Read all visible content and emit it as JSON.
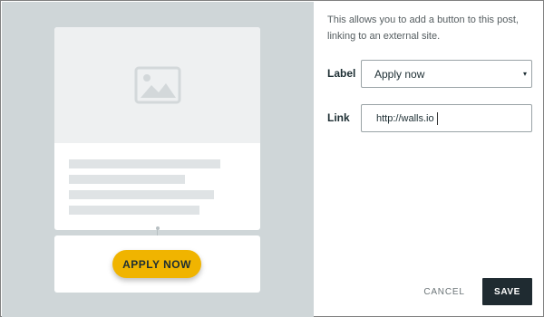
{
  "preview": {
    "image_icon": "image-placeholder-icon",
    "button_label": "APPLY NOW",
    "button_color": "#f0b400"
  },
  "form": {
    "description": "This allows you to add a button to this post, linking to an external site.",
    "label_field": {
      "label": "Label",
      "selected": "Apply now",
      "caret": "▾"
    },
    "link_field": {
      "label": "Link",
      "value": "http://walls.io"
    },
    "cancel_label": "CANCEL",
    "save_label": "SAVE"
  },
  "colors": {
    "preview_bg": "#cfd6d8",
    "save_bg": "#1f2b31"
  }
}
